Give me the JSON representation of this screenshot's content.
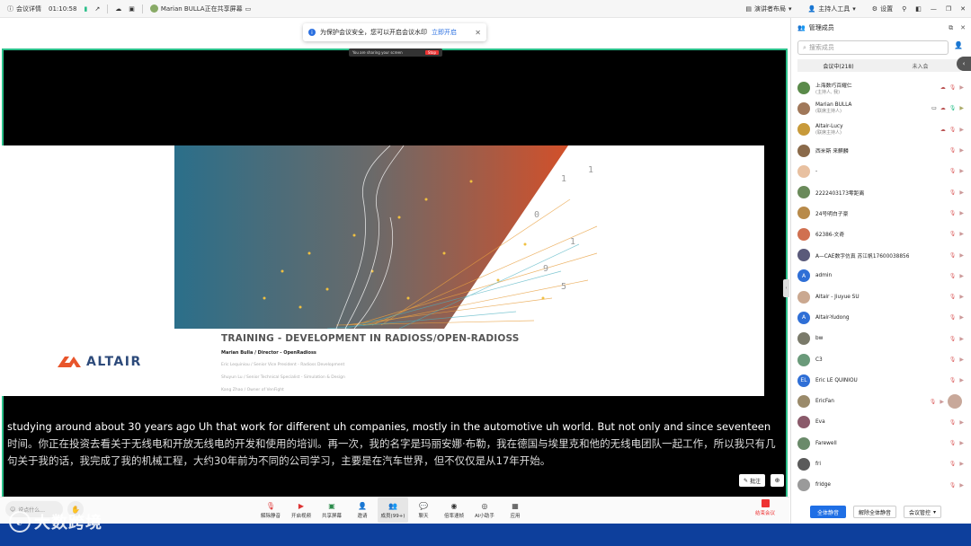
{
  "topbar": {
    "meeting_details": "会议详情",
    "timer": "01:10:58",
    "sharing_status": "Marian BULLA正在共享屏幕",
    "speaker_layout": "演讲者布局",
    "host_tools": "主持人工具",
    "settings": "设置"
  },
  "notice": {
    "text": "为保护会议安全，您可以开启会议水印",
    "link": "立即开启"
  },
  "sharebar": {
    "text": "You are sharing your screen",
    "stop": "Stop"
  },
  "slide": {
    "title": "TRAINING - DEVELOPMENT IN RADIOSS/OPEN-RADIOSS",
    "author": "Marian Bulla / Director - OpenRadioss",
    "lines": [
      "Eric Lequiniou / Senior Vice President - Radioss Development",
      "Shuyun Lu / Senior Technical Specialist - Simulation & Design",
      "Kang Zhao / Owner of VenFight"
    ],
    "brand": "ALTAIR"
  },
  "caption": {
    "en": "studying around about 30 years ago Uh that work for different uh companies, mostly in the automotive uh world. But not only and since seventeen",
    "zh": "时间。你正在投资去看关于无线电和开放无线电的开发和使用的培训。再一次，我的名字是玛丽安娜·布勒，我在德国与埃里克和他的无线电团队一起工作，所以我只有几句关于我的话，我完成了我的机械工程，大约30年前为不同的公司学习，主要是在汽车世界，但不仅仅是从17年开始。"
  },
  "annotate": "批注",
  "chat_placeholder": "说点什么...",
  "toolbar": [
    {
      "label": "解除静音",
      "icon": "mic-off-icon"
    },
    {
      "label": "开启视频",
      "icon": "camera-off-icon"
    },
    {
      "label": "共享屏幕",
      "icon": "share-screen-icon"
    },
    {
      "label": "邀请",
      "icon": "invite-icon"
    },
    {
      "label": "成员(99+)",
      "icon": "members-icon"
    },
    {
      "label": "聊天",
      "icon": "chat-icon"
    },
    {
      "label": "倍率速帧",
      "icon": "record-icon"
    },
    {
      "label": "AI小助手",
      "icon": "ai-assistant-icon"
    },
    {
      "label": "应用",
      "icon": "apps-icon"
    }
  ],
  "end_meeting": "结束会议",
  "panel": {
    "title": "管理成员",
    "search_placeholder": "搜索成员",
    "tab_in_meeting": "会议中(218)",
    "tab_not_joined": "未入会",
    "members": [
      {
        "name": "上海数巧百耀仁",
        "role": "(主持人, 我)",
        "color": "#5a8a4a"
      },
      {
        "name": "Marian BULLA",
        "role": "(联席主持人)",
        "color": "#a0785a"
      },
      {
        "name": "Altair-Lucy",
        "role": "(联席主持人)",
        "color": "#c89a3a"
      },
      {
        "name": "西米斯 来麒麟",
        "role": "",
        "color": "#8a6a4a"
      },
      {
        "name": "-",
        "role": "",
        "color": "#e8c0a0"
      },
      {
        "name": "2222403173零距离",
        "role": "",
        "color": "#6a8a5a"
      },
      {
        "name": "24号明白子豪",
        "role": "",
        "color": "#b88a4a"
      },
      {
        "name": "62386-文奇",
        "role": "",
        "color": "#d07050"
      },
      {
        "name": "A—CAE数字仿真 苏江帆17600038856",
        "role": "",
        "color": "#5a5a7a"
      },
      {
        "name": "admin",
        "role": "",
        "color": "#2f6fd6",
        "initial": "A"
      },
      {
        "name": "Altair - Jiuyue SU",
        "role": "",
        "color": "#caa890"
      },
      {
        "name": "Altair-Yudong",
        "role": "",
        "color": "#2f6fd6",
        "initial": "A"
      },
      {
        "name": "bw",
        "role": "",
        "color": "#7a7a6a"
      },
      {
        "name": "C3",
        "role": "",
        "color": "#6a9a7a"
      },
      {
        "name": "Eric LE QUINIOU",
        "role": "",
        "color": "#2f6fd6",
        "initial": "EL"
      },
      {
        "name": "EricFan",
        "role": "",
        "color": "#9a8a6a"
      },
      {
        "name": "Eva",
        "role": "",
        "color": "#8a5a6a"
      },
      {
        "name": "Farewell",
        "role": "",
        "color": "#6a8a6a"
      },
      {
        "name": "fri",
        "role": "",
        "color": "#5a5a5a"
      },
      {
        "name": "fridge",
        "role": "",
        "color": "#9a9a9a"
      }
    ],
    "mute_all": "全体静音",
    "unmute_all": "解除全体静音",
    "meeting_control": "会议管控"
  },
  "watermark": "大数跨境",
  "colors": {
    "accent": "#1f6fe5",
    "share_border": "#2bbf8a",
    "banner": "#0d3f9c"
  }
}
